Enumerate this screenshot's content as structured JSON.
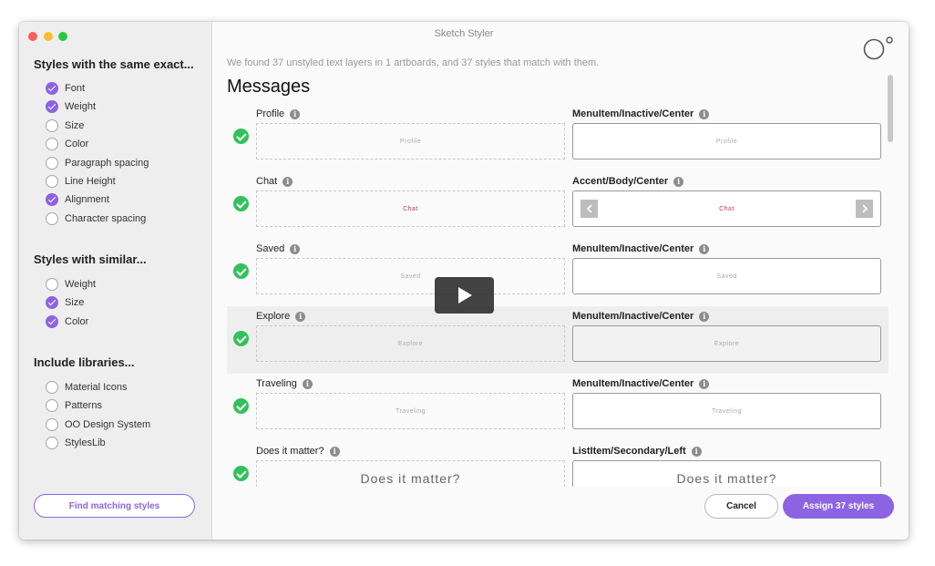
{
  "window": {
    "title": "Sketch Styler"
  },
  "sidebar": {
    "exact": {
      "title": "Styles with the same exact...",
      "options": [
        {
          "label": "Font",
          "checked": true
        },
        {
          "label": "Weight",
          "checked": true
        },
        {
          "label": "Size",
          "checked": false
        },
        {
          "label": "Color",
          "checked": false
        },
        {
          "label": "Paragraph spacing",
          "checked": false
        },
        {
          "label": "Line Height",
          "checked": false
        },
        {
          "label": "Alignment",
          "checked": true
        },
        {
          "label": "Character spacing",
          "checked": false
        }
      ]
    },
    "similar": {
      "title": "Styles with similar...",
      "options": [
        {
          "label": "Weight",
          "checked": false
        },
        {
          "label": "Size",
          "checked": true
        },
        {
          "label": "Color",
          "checked": true
        }
      ]
    },
    "libraries": {
      "title": "Include libraries...",
      "options": [
        {
          "label": "Material Icons",
          "checked": false
        },
        {
          "label": "Patterns",
          "checked": false
        },
        {
          "label": "OO Design System",
          "checked": false
        },
        {
          "label": "StylesLib",
          "checked": false
        }
      ]
    },
    "find_button": "Find matching styles"
  },
  "main": {
    "summary": "We found 37 unstyled text layers in 1 artboards, and 37 styles that match with them.",
    "title": "Messages",
    "rows": [
      {
        "layer": "Profile",
        "style": "MenuItem/Inactive/Center",
        "preview": "Profile",
        "match_preview": "Profile"
      },
      {
        "layer": "Chat",
        "style": "Accent/Body/Center",
        "preview": "Chat",
        "match_preview": "Chat"
      },
      {
        "layer": "Saved",
        "style": "MenuItem/Inactive/Center",
        "preview": "Saved",
        "match_preview": "Saved"
      },
      {
        "layer": "Explore",
        "style": "MenuItem/Inactive/Center",
        "preview": "Explore",
        "match_preview": "Explore"
      },
      {
        "layer": "Traveling",
        "style": "MenuItem/Inactive/Center",
        "preview": "Traveling",
        "match_preview": "Traveling"
      },
      {
        "layer": "Does it matter?",
        "style": "ListItem/Secondary/Left",
        "preview": "Does it matter?",
        "match_preview": "Does it matter?"
      }
    ]
  },
  "footer": {
    "cancel": "Cancel",
    "assign": "Assign 37 styles"
  },
  "colors": {
    "accent": "#8c64e3",
    "success": "#32c15b",
    "chat_accent": "#d0354d"
  },
  "icons": {
    "info": "info-icon",
    "check": "check-circle-icon",
    "play": "play-icon",
    "logo": "app-logo-icon"
  }
}
